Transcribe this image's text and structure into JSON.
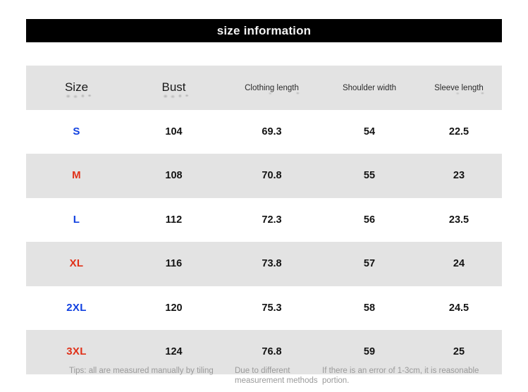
{
  "banner": {
    "title": "size information"
  },
  "table": {
    "headers": [
      {
        "label": "Size",
        "style": "large"
      },
      {
        "label": "Bust",
        "style": "large"
      },
      {
        "label": "Clothing length",
        "style": "small"
      },
      {
        "label": "Shoulder width",
        "style": "small"
      },
      {
        "label": "Sleeve length",
        "style": "small-wrap"
      }
    ],
    "rows": [
      {
        "size": "S",
        "size_color": "#1040e0",
        "shaded": false,
        "bust": "104",
        "clothing_length": "69.3",
        "shoulder_width": "54",
        "sleeve_length": "22.5"
      },
      {
        "size": "M",
        "size_color": "#e03018",
        "shaded": true,
        "bust": "108",
        "clothing_length": "70.8",
        "shoulder_width": "55",
        "sleeve_length": "23"
      },
      {
        "size": "L",
        "size_color": "#1040e0",
        "shaded": false,
        "bust": "112",
        "clothing_length": "72.3",
        "shoulder_width": "56",
        "sleeve_length": "23.5"
      },
      {
        "size": "XL",
        "size_color": "#e03018",
        "shaded": true,
        "bust": "116",
        "clothing_length": "73.8",
        "shoulder_width": "57",
        "sleeve_length": "24"
      },
      {
        "size": "2XL",
        "size_color": "#1040e0",
        "shaded": false,
        "bust": "120",
        "clothing_length": "75.3",
        "shoulder_width": "58",
        "sleeve_length": "24.5"
      },
      {
        "size": "3XL",
        "size_color": "#e03018",
        "shaded": true,
        "bust": "124",
        "clothing_length": "76.8",
        "shoulder_width": "59",
        "sleeve_length": "25"
      }
    ]
  },
  "tips": {
    "part_one": "Tips: all are measured manually by tiling",
    "part_two": "Due to different measurement methods",
    "part_three": "If there is an error of 1-3cm, it is reasonable portion."
  },
  "colors": {
    "banner_background": "#000000",
    "banner_text": "#f2f2f2",
    "row_shaded": "#e3e3e3",
    "row_plain": "#ffffff",
    "blue_size": "#1040e0",
    "red_size": "#e03018",
    "tips_text": "#9a9a9a"
  }
}
